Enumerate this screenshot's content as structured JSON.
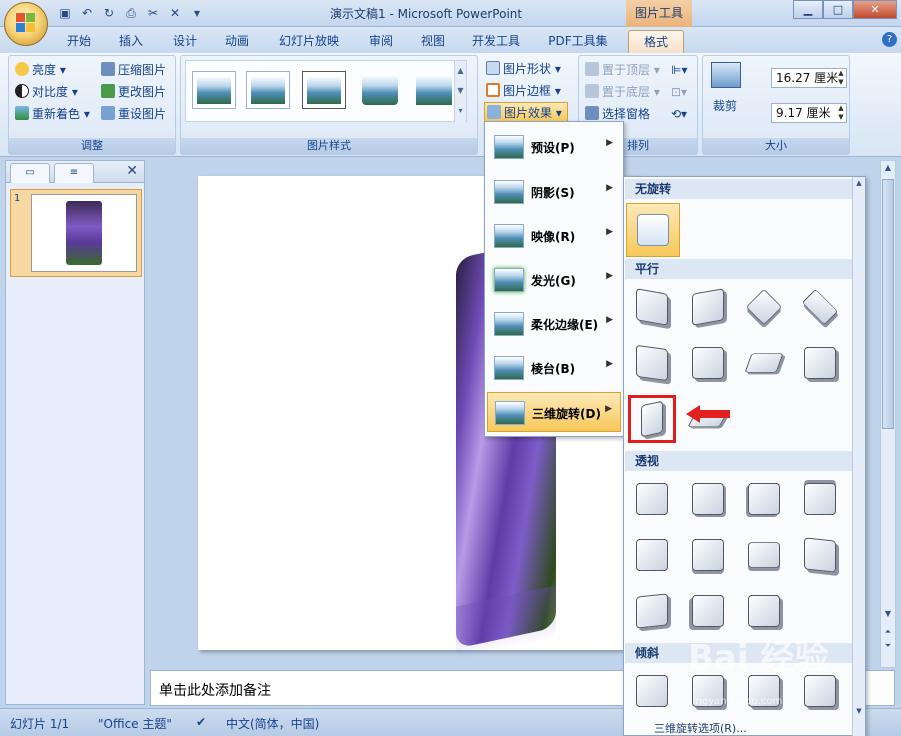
{
  "window": {
    "title": "演示文稿1 - Microsoft PowerPoint",
    "context_tab_title": "图片工具"
  },
  "tabs": [
    "开始",
    "插入",
    "设计",
    "动画",
    "幻灯片放映",
    "审阅",
    "视图",
    "开发工具",
    "PDF工具集",
    "格式"
  ],
  "ribbon": {
    "adjust": {
      "label": "调整",
      "brightness": "亮度",
      "contrast": "对比度",
      "recolor": "重新着色",
      "compress": "压缩图片",
      "change": "更改图片",
      "reset": "重设图片"
    },
    "styles": {
      "label": "图片样式",
      "shape": "图片形状",
      "border": "图片边框",
      "effects": "图片效果"
    },
    "arrange": {
      "label": "排列",
      "front": "置于顶层",
      "back": "置于底层",
      "selection": "选择窗格"
    },
    "size": {
      "label": "大小",
      "crop": "裁剪",
      "height": "16.27 厘米",
      "width": "9.17 厘米"
    }
  },
  "effects_menu": [
    "预设(P)",
    "阴影(S)",
    "映像(R)",
    "发光(G)",
    "柔化边缘(E)",
    "棱台(B)",
    "三维旋转(D)"
  ],
  "rotation_menu": {
    "sections": [
      "无旋转",
      "平行",
      "透视",
      "倾斜"
    ],
    "options_label": "三维旋转选项(R)..."
  },
  "slide_panel": {
    "slide_number": "1"
  },
  "notes_placeholder": "单击此处添加备注",
  "status": {
    "slide": "幻灯片 1/1",
    "theme": "\"Office 主题\"",
    "language": "中文(简体，中国)"
  },
  "watermark": {
    "text": "Bai 经验",
    "url": "jingyan.baidu.com"
  }
}
